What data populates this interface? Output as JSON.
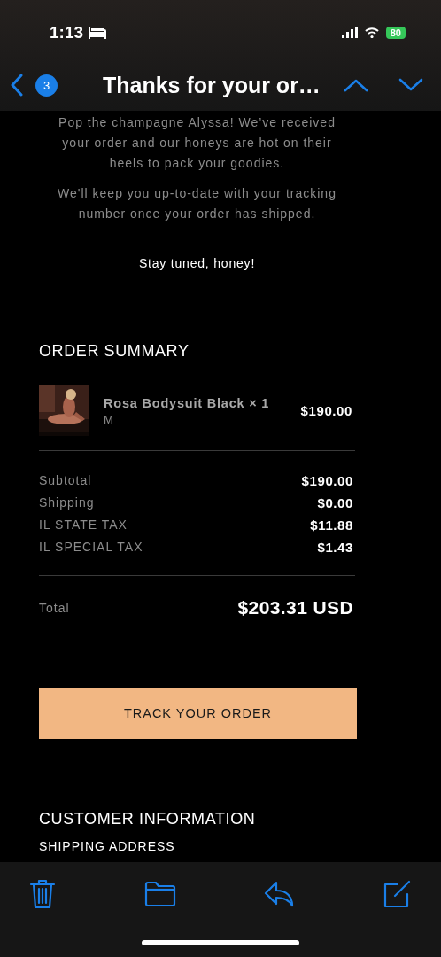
{
  "status_bar": {
    "time": "1:13",
    "battery": "80"
  },
  "nav": {
    "badge": "3",
    "title": "Thanks for your or…"
  },
  "message": {
    "paragraphs": [
      "Pop the champagne Alyssa! We’ve received your order and our honeys are hot on their heels to pack your goodies.",
      "We'll keep you up-to-date with your tracking number once your order has shipped."
    ],
    "sign_off": "Stay tuned, honey!",
    "order_summary": {
      "heading": "ORDER SUMMARY",
      "items": [
        {
          "name": "Rosa Bodysuit Black × 1",
          "variant": "M",
          "price": "$190.00"
        }
      ],
      "lines": [
        {
          "label": "Subtotal",
          "value": "$190.00"
        },
        {
          "label": "Shipping",
          "value": "$0.00"
        },
        {
          "label": "IL STATE TAX",
          "value": "$11.88"
        },
        {
          "label": "IL SPECIAL TAX",
          "value": "$1.43"
        }
      ],
      "total": {
        "label": "Total",
        "value": "$203.31 USD"
      }
    },
    "button": "TRACK YOUR ORDER",
    "customer_information": {
      "heading": "CUSTOMER INFORMATION",
      "subheading": "SHIPPING ADDRESS"
    }
  }
}
